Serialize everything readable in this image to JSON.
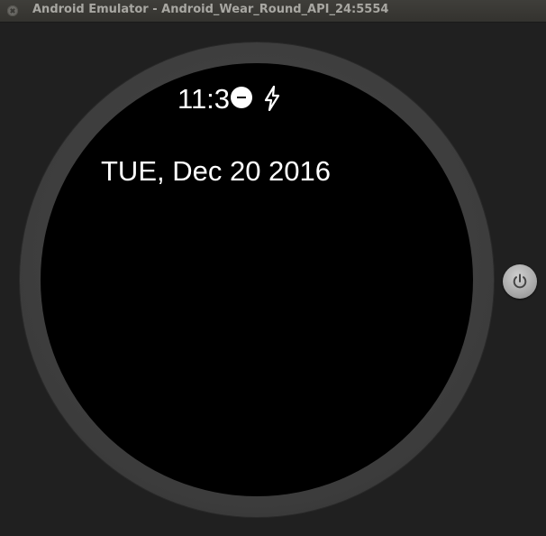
{
  "window": {
    "title": "Android Emulator - Android_Wear_Round_API_24:5554"
  },
  "watch": {
    "time": "11:3",
    "date": "TUE, Dec 20 2016",
    "status_icons": [
      "do-not-disturb-icon",
      "charging-bolt-icon"
    ]
  },
  "side_controls": {
    "power_icon": "power-icon"
  },
  "colors": {
    "window_background": "#202020",
    "titlebar": "#3a3935",
    "bezel": "#404040",
    "screen": "#000000",
    "text": "#ffffff"
  }
}
